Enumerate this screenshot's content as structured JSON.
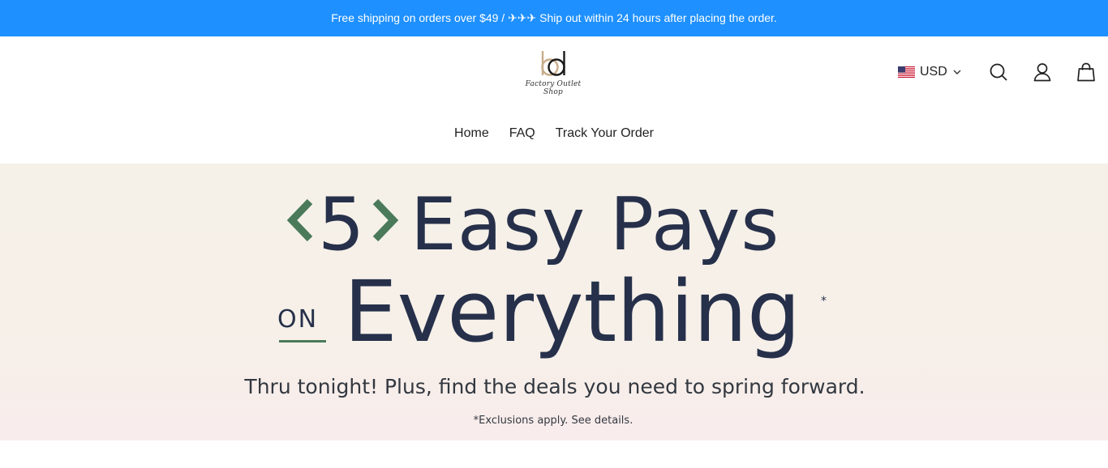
{
  "announcement": {
    "text": "Free shipping on orders over $49 / ✈✈✈ Ship out within 24 hours after placing the order."
  },
  "header": {
    "logo": {
      "mark": "bd",
      "text": "Factory Outlet Shop"
    },
    "currency": {
      "flag": "us-flag-icon",
      "code": "USD"
    },
    "icons": [
      "search-icon",
      "account-icon",
      "cart-icon"
    ]
  },
  "nav": {
    "items": [
      "Home",
      "FAQ",
      "Track Your Order"
    ]
  },
  "banner": {
    "number": "5",
    "headline_rest": "Easy Pays",
    "on": "ON",
    "everything": "Everything",
    "asterisk": "*",
    "subline": "Thru tonight! Plus, find the deals you need to spring forward.",
    "note": "*Exclusions apply. See details.",
    "colors": {
      "text": "#26304a",
      "accent": "#4a7a5a",
      "background": "#f5f1e8"
    }
  },
  "colors": {
    "announcement_bg": "#1e90ff",
    "announcement_text": "#ffffff"
  }
}
